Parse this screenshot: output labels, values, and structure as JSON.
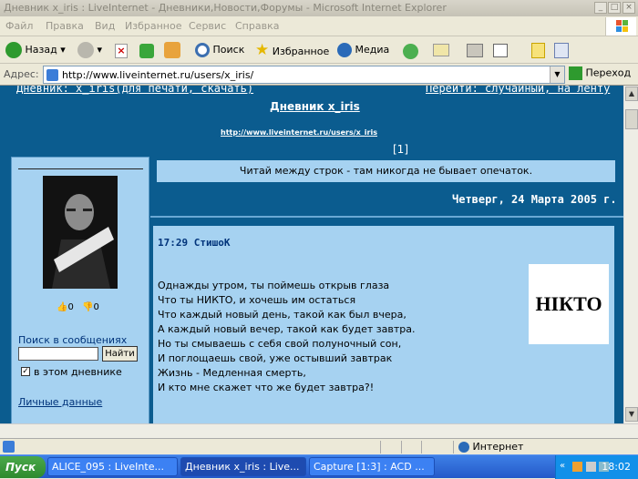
{
  "window": {
    "title": "Дневник x_iris : LiveInternet - Дневники,Новости,Форумы - Microsoft Internet Explorer"
  },
  "menu": [
    "Файл",
    "Правка",
    "Вид",
    "Избранное",
    "Сервис",
    "Справка"
  ],
  "toolbar": {
    "back": "Назад",
    "search": "Поиск",
    "favorites": "Избранное",
    "media": "Медиа"
  },
  "address": {
    "label": "Адрес:",
    "url": "http://www.liveinternet.ru/users/x_iris/",
    "go": "Переход"
  },
  "page": {
    "nav_left": "Дневник: x_iris(для печати, скачать)",
    "nav_right": "Перейти: случайный, на ленту",
    "diary_title": "Дневник x_iris",
    "diary_url": "http://www.liveinternet.ru/users/x_iris",
    "page_num": "[1]",
    "quote": "Читай между строк - там никогда не бывает опечаток.",
    "date": "Четверг, 24 Марта 2005 г.",
    "sidebar": {
      "rating_up": "0",
      "rating_down": "0",
      "search_label": "Поиск в сообщениях",
      "find_button": "Найти",
      "checkbox_label": "в этом дневнике",
      "personal": "Личные данные"
    },
    "post": {
      "title": "17:29 СтишоК",
      "image_text": "НIКТО",
      "lines": [
        "Однажды утром, ты поймешь открыв глаза",
        "Что ты НИКТО, и хочешь им остаться",
        "Что каждый новый день, такой как был вчера,",
        "А каждый новый вечер, такой как будет завтра.",
        "Но ты смываешь с себя свой полуночный сон,",
        "И поглощаешь свой, уже остывший завтрак",
        "Жизнь - Медленная смерть,",
        "И кто мне скажет что же будет завтра?!"
      ]
    }
  },
  "status": {
    "zone": "Интернет"
  },
  "taskbar": {
    "start": "Пуск",
    "tasks": [
      "ALICE_095 : LiveInte...",
      "Дневник x_iris : Live...",
      "Capture [1:3] : ACD ..."
    ],
    "clock": "18:02"
  }
}
